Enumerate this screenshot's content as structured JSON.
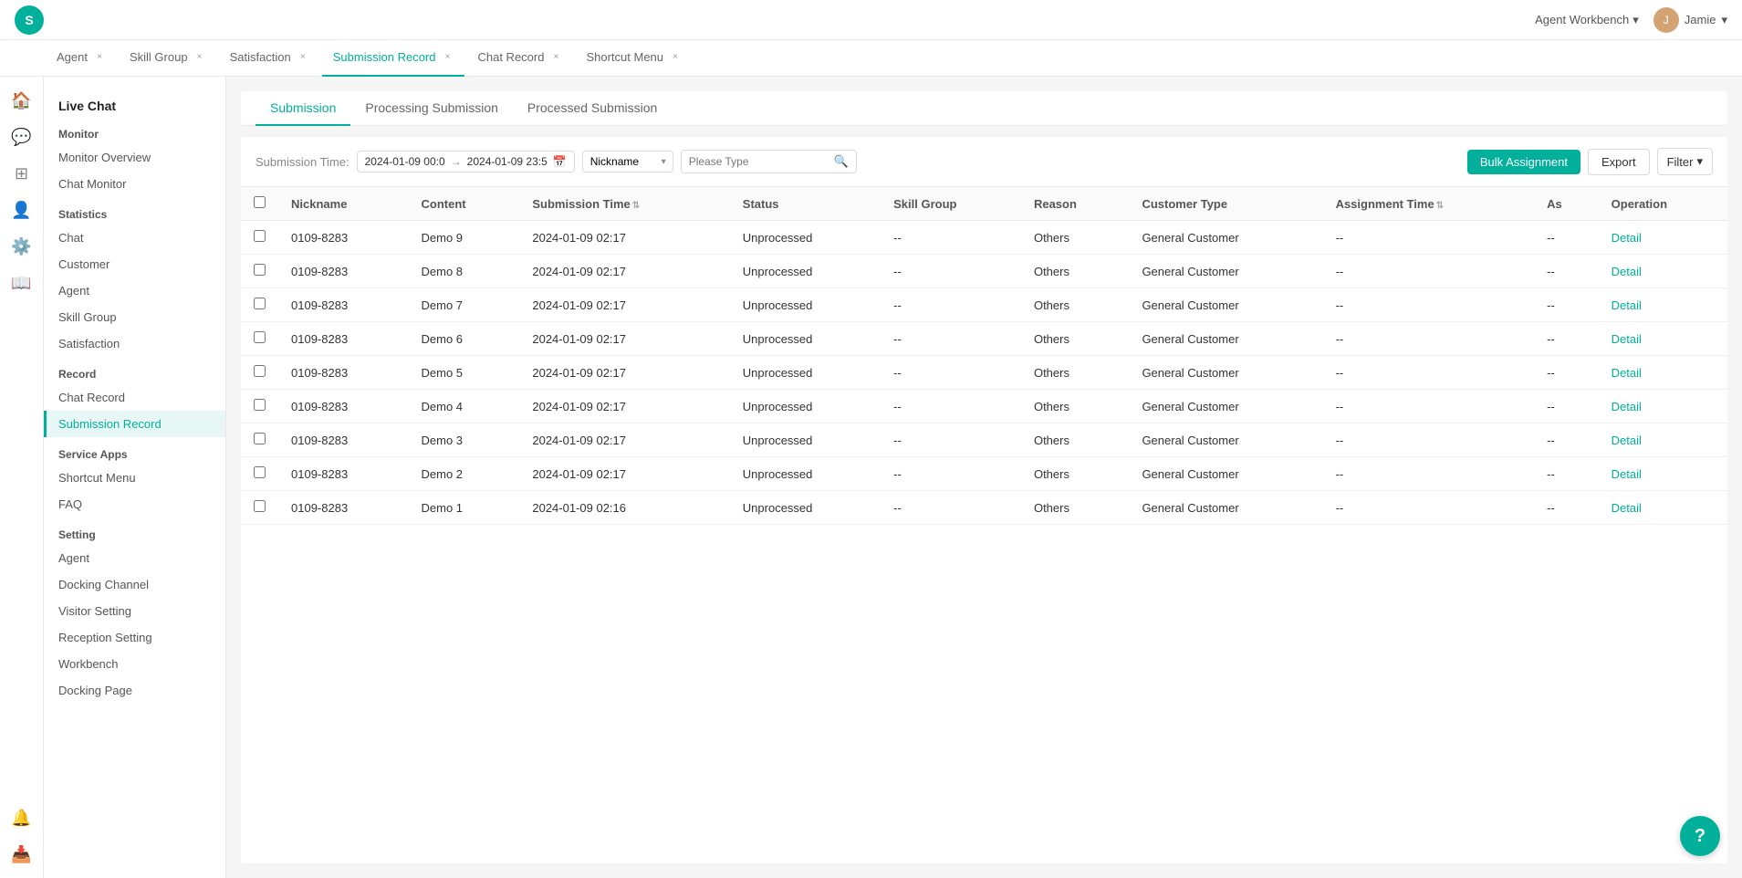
{
  "topbar": {
    "logo": "S",
    "workbench_label": "Agent Workbench",
    "user_name": "Jamie",
    "user_avatar": "J"
  },
  "tabs": [
    {
      "id": "agent",
      "label": "Agent",
      "active": false,
      "closable": true
    },
    {
      "id": "skill-group",
      "label": "Skill Group",
      "active": false,
      "closable": true
    },
    {
      "id": "satisfaction",
      "label": "Satisfaction",
      "active": false,
      "closable": true
    },
    {
      "id": "submission-record",
      "label": "Submission Record",
      "active": true,
      "closable": true
    },
    {
      "id": "chat-record",
      "label": "Chat Record",
      "active": false,
      "closable": true
    },
    {
      "id": "shortcut-menu",
      "label": "Shortcut Menu",
      "active": false,
      "closable": true
    }
  ],
  "nav": {
    "section": "Live Chat",
    "groups": [
      {
        "label": "Monitor",
        "items": [
          {
            "id": "monitor-overview",
            "label": "Monitor Overview",
            "active": false
          },
          {
            "id": "chat-monitor",
            "label": "Chat Monitor",
            "active": false
          }
        ]
      },
      {
        "label": "Statistics",
        "items": [
          {
            "id": "chat",
            "label": "Chat",
            "active": false
          },
          {
            "id": "customer",
            "label": "Customer",
            "active": false
          },
          {
            "id": "agent",
            "label": "Agent",
            "active": false
          },
          {
            "id": "skill-group",
            "label": "Skill Group",
            "active": false
          },
          {
            "id": "satisfaction",
            "label": "Satisfaction",
            "active": false
          }
        ]
      },
      {
        "label": "Record",
        "items": [
          {
            "id": "chat-record",
            "label": "Chat Record",
            "active": false
          },
          {
            "id": "submission-record",
            "label": "Submission Record",
            "active": true
          }
        ]
      },
      {
        "label": "Service Apps",
        "items": [
          {
            "id": "shortcut-menu",
            "label": "Shortcut Menu",
            "active": false
          },
          {
            "id": "faq",
            "label": "FAQ",
            "active": false
          }
        ]
      },
      {
        "label": "Setting",
        "items": [
          {
            "id": "agent-setting",
            "label": "Agent",
            "active": false
          },
          {
            "id": "docking-channel",
            "label": "Docking Channel",
            "active": false
          },
          {
            "id": "visitor-setting",
            "label": "Visitor Setting",
            "active": false
          },
          {
            "id": "reception-setting",
            "label": "Reception Setting",
            "active": false
          },
          {
            "id": "workbench",
            "label": "Workbench",
            "active": false
          },
          {
            "id": "docking-page",
            "label": "Docking Page",
            "active": false
          }
        ]
      }
    ]
  },
  "subtabs": [
    {
      "id": "submission",
      "label": "Submission",
      "active": true
    },
    {
      "id": "processing",
      "label": "Processing Submission",
      "active": false
    },
    {
      "id": "processed",
      "label": "Processed Submission",
      "active": false
    }
  ],
  "filters": {
    "date_label": "Submission Time:",
    "date_from": "2024-01-09 00:0",
    "date_to": "2024-01-09 23:5",
    "search_type": "Nickname",
    "search_placeholder": "Please Type",
    "bulk_assignment_label": "Bulk Assignment",
    "export_label": "Export",
    "filter_label": "Filter"
  },
  "table": {
    "columns": [
      {
        "id": "nickname",
        "label": "Nickname",
        "sortable": false
      },
      {
        "id": "content",
        "label": "Content",
        "sortable": false
      },
      {
        "id": "submission_time",
        "label": "Submission Time",
        "sortable": true
      },
      {
        "id": "status",
        "label": "Status",
        "sortable": false
      },
      {
        "id": "skill_group",
        "label": "Skill Group",
        "sortable": false
      },
      {
        "id": "reason",
        "label": "Reason",
        "sortable": false
      },
      {
        "id": "customer_type",
        "label": "Customer Type",
        "sortable": false
      },
      {
        "id": "assignment_time",
        "label": "Assignment Time",
        "sortable": true
      },
      {
        "id": "as",
        "label": "As",
        "sortable": false
      },
      {
        "id": "operation",
        "label": "Operation",
        "sortable": false
      }
    ],
    "rows": [
      {
        "nickname": "0109-8283",
        "content": "Demo 9",
        "submission_time": "2024-01-09 02:17",
        "status": "Unprocessed",
        "skill_group": "--",
        "reason": "Others",
        "customer_type": "General Customer",
        "assignment_time": "--",
        "as": "--",
        "operation": "Detail"
      },
      {
        "nickname": "0109-8283",
        "content": "Demo 8",
        "submission_time": "2024-01-09 02:17",
        "status": "Unprocessed",
        "skill_group": "--",
        "reason": "Others",
        "customer_type": "General Customer",
        "assignment_time": "--",
        "as": "--",
        "operation": "Detail"
      },
      {
        "nickname": "0109-8283",
        "content": "Demo 7",
        "submission_time": "2024-01-09 02:17",
        "status": "Unprocessed",
        "skill_group": "--",
        "reason": "Others",
        "customer_type": "General Customer",
        "assignment_time": "--",
        "as": "--",
        "operation": "Detail"
      },
      {
        "nickname": "0109-8283",
        "content": "Demo 6",
        "submission_time": "2024-01-09 02:17",
        "status": "Unprocessed",
        "skill_group": "--",
        "reason": "Others",
        "customer_type": "General Customer",
        "assignment_time": "--",
        "as": "--",
        "operation": "Detail"
      },
      {
        "nickname": "0109-8283",
        "content": "Demo 5",
        "submission_time": "2024-01-09 02:17",
        "status": "Unprocessed",
        "skill_group": "--",
        "reason": "Others",
        "customer_type": "General Customer",
        "assignment_time": "--",
        "as": "--",
        "operation": "Detail"
      },
      {
        "nickname": "0109-8283",
        "content": "Demo 4",
        "submission_time": "2024-01-09 02:17",
        "status": "Unprocessed",
        "skill_group": "--",
        "reason": "Others",
        "customer_type": "General Customer",
        "assignment_time": "--",
        "as": "--",
        "operation": "Detail"
      },
      {
        "nickname": "0109-8283",
        "content": "Demo 3",
        "submission_time": "2024-01-09 02:17",
        "status": "Unprocessed",
        "skill_group": "--",
        "reason": "Others",
        "customer_type": "General Customer",
        "assignment_time": "--",
        "as": "--",
        "operation": "Detail"
      },
      {
        "nickname": "0109-8283",
        "content": "Demo 2",
        "submission_time": "2024-01-09 02:17",
        "status": "Unprocessed",
        "skill_group": "--",
        "reason": "Others",
        "customer_type": "General Customer",
        "assignment_time": "--",
        "as": "--",
        "operation": "Detail"
      },
      {
        "nickname": "0109-8283",
        "content": "Demo 1",
        "submission_time": "2024-01-09 02:16",
        "status": "Unprocessed",
        "skill_group": "--",
        "reason": "Others",
        "customer_type": "General Customer",
        "assignment_time": "--",
        "as": "--",
        "operation": "Detail"
      }
    ]
  },
  "help": {
    "label": "?"
  }
}
